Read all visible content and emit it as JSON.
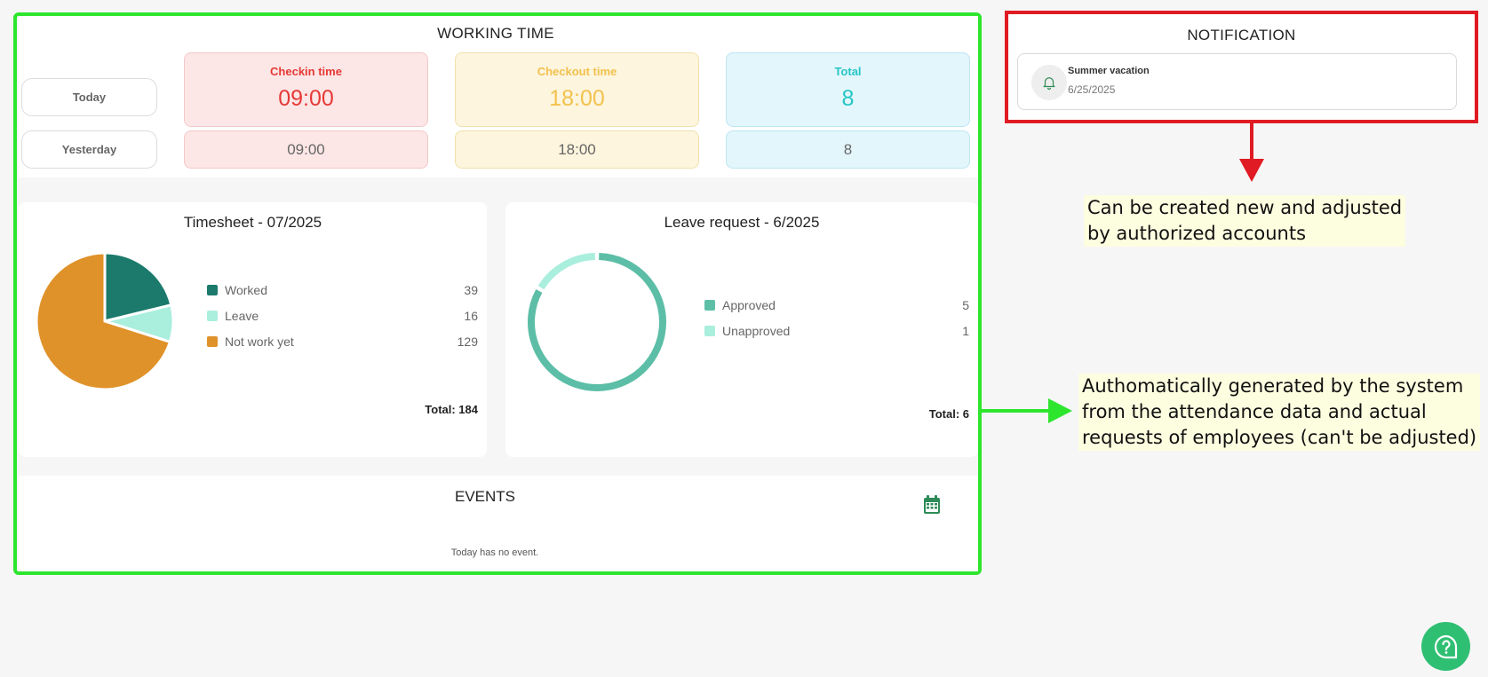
{
  "working_time": {
    "title": "WORKING TIME",
    "rows": [
      "Today",
      "Yesterday"
    ],
    "checkin_label": "Checkin time",
    "checkout_label": "Checkout time",
    "total_label": "Total",
    "today": {
      "checkin": "09:00",
      "checkout": "18:00",
      "total": "8"
    },
    "yesterday": {
      "checkin": "09:00",
      "checkout": "18:00",
      "total": "8"
    },
    "colors": {
      "checkin": "#e53935",
      "checkout": "#f2c14e",
      "total": "#26c6c6"
    }
  },
  "timesheet": {
    "title": "Timesheet - 07/2025",
    "total_text": "Total: 184"
  },
  "leave_request": {
    "title": "Leave request - 6/2025",
    "total_text": "Total: 6"
  },
  "chart_data": [
    {
      "type": "pie",
      "title": "Timesheet - 07/2025",
      "categories": [
        "Worked",
        "Leave",
        "Not work yet"
      ],
      "values": [
        39,
        16,
        129
      ],
      "colors": [
        "#1b7a6c",
        "#aaeedd",
        "#e0922a"
      ],
      "legend": "right",
      "total": 184
    },
    {
      "type": "pie",
      "title": "Leave request - 6/2025",
      "categories": [
        "Approved",
        "Unapproved"
      ],
      "values": [
        5,
        1
      ],
      "colors": [
        "#5cbea6",
        "#aaeedd"
      ],
      "legend": "right",
      "total": 6,
      "donut": true
    }
  ],
  "events": {
    "title": "EVENTS",
    "empty_text": "Today has no event.",
    "icon": "calendar-icon",
    "icon_color": "#2e8b57"
  },
  "notification": {
    "title": "NOTIFICATION",
    "items": [
      {
        "name": "Summer vacation",
        "date": "6/25/2025",
        "icon": "bell-icon"
      }
    ]
  },
  "annotations": {
    "notification_note": [
      "Can be created new and adjusted",
      "by authorized accounts"
    ],
    "system_note": [
      "Authomatically generated by the system",
      "from the attendance data and actual",
      "requests of employees (can't be adjusted)"
    ],
    "frame_colors": {
      "green": "#2ee52e",
      "red": "#e01b24"
    }
  },
  "help": {
    "icon": "help-chat-icon",
    "color": "#2fbf73"
  }
}
